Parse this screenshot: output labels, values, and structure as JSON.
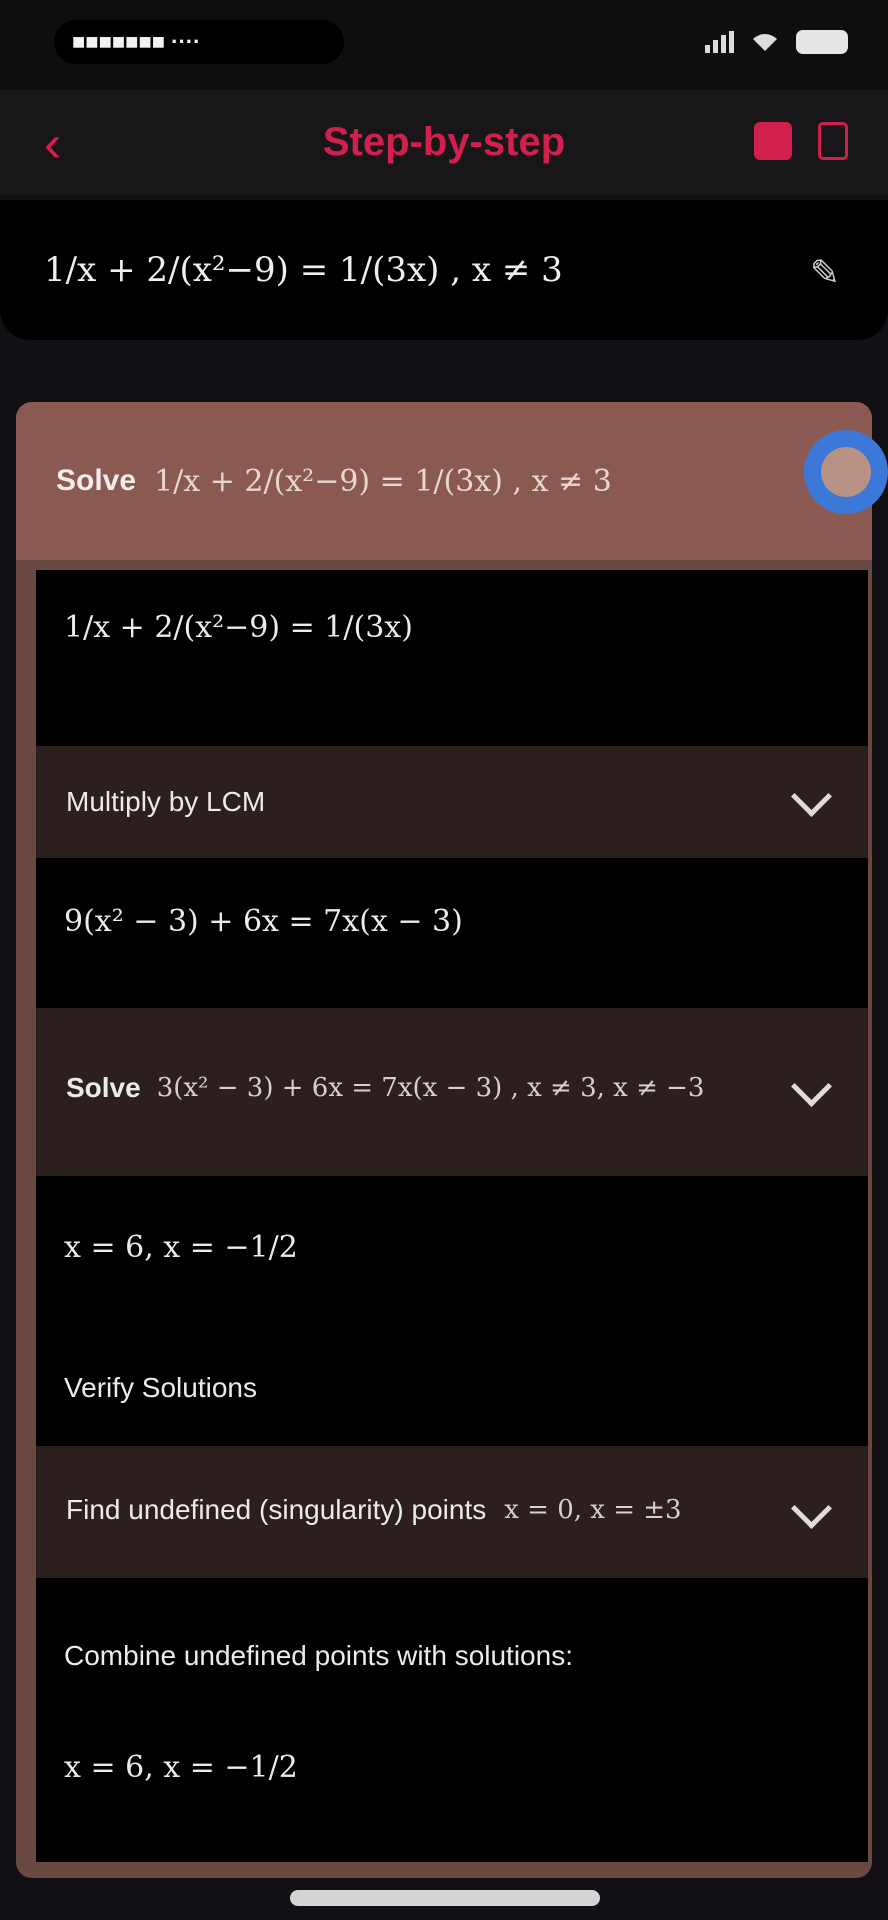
{
  "status_bar": {
    "pill_text": "■■■■■■■ ····",
    "battery": "battery-icon",
    "wifi": "wifi-icon",
    "signal": "signal-icon"
  },
  "nav": {
    "back_icon": "chevron-left-icon",
    "title": "Step-by-step",
    "accent_color": "#d1204e"
  },
  "equation": {
    "expression": "1/x + 2/(x²−9) = 1/(3x) , x ≠ 3",
    "edit_icon": "pencil-icon"
  },
  "card": {
    "header": {
      "label": "Solve",
      "expression": "1/x + 2/(x²−9) = 1/(3x) ,  x ≠ 3",
      "header_color": "#8a5a52"
    },
    "steps": [
      {
        "type": "math",
        "text": "1/x + 2/(x²−9) = 1/(3x)"
      },
      {
        "type": "section",
        "title": "Multiply by LCM"
      },
      {
        "type": "math",
        "text": "9(x² − 3) + 6x = 7x(x − 3)"
      },
      {
        "type": "section",
        "title": "Solve",
        "expression": "3(x² − 3) + 6x = 7x(x − 3) ,  x ≠ 3, x ≠ −3"
      },
      {
        "type": "math",
        "text": "x = 6, x = −1/2"
      },
      {
        "type": "text",
        "text": "Verify Solutions"
      },
      {
        "type": "section",
        "title": "Find undefined (singularity) points",
        "expression": "x = 0, x = ±3"
      },
      {
        "type": "text",
        "text": "Combine undefined points with solutions:"
      },
      {
        "type": "math",
        "text": "x = 6, x = −1/2"
      }
    ]
  }
}
